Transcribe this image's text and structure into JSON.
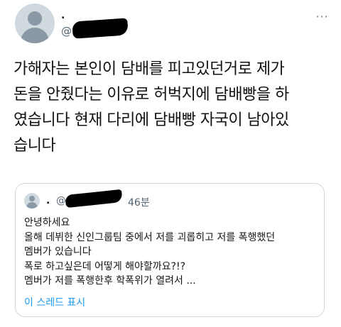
{
  "author": {
    "name": ".",
    "handle": "@"
  },
  "tweet": {
    "lines": [
      "가해자는 본인이 담배를 피고있던거로 제가",
      "돈을 안줬다는 이유로 허벅지에 담배빵을 하",
      "였습니다 현재 다리에 담배빵 자국이 남아있",
      "습니다"
    ]
  },
  "quoted": {
    "name": ".",
    "handle": "@",
    "time": "46분",
    "lines": [
      "안녕하세요",
      "올해 데뷔한 신인그룹팀 중에서 저를 괴롭히고 저를 폭행했던",
      "멤버가 있습니다",
      "폭로 하고싶은데 어떻게 해야할까요?!?",
      "멤버가 저를 폭행한후 학폭위가 열려서 ..."
    ],
    "show_thread": "이 스레드 표시"
  },
  "icons": {
    "more": "more-options-icon",
    "avatar": "default-avatar-icon"
  },
  "colors": {
    "link": "#1d9bf0",
    "secondary": "#536471",
    "border": "#cfd9de"
  }
}
